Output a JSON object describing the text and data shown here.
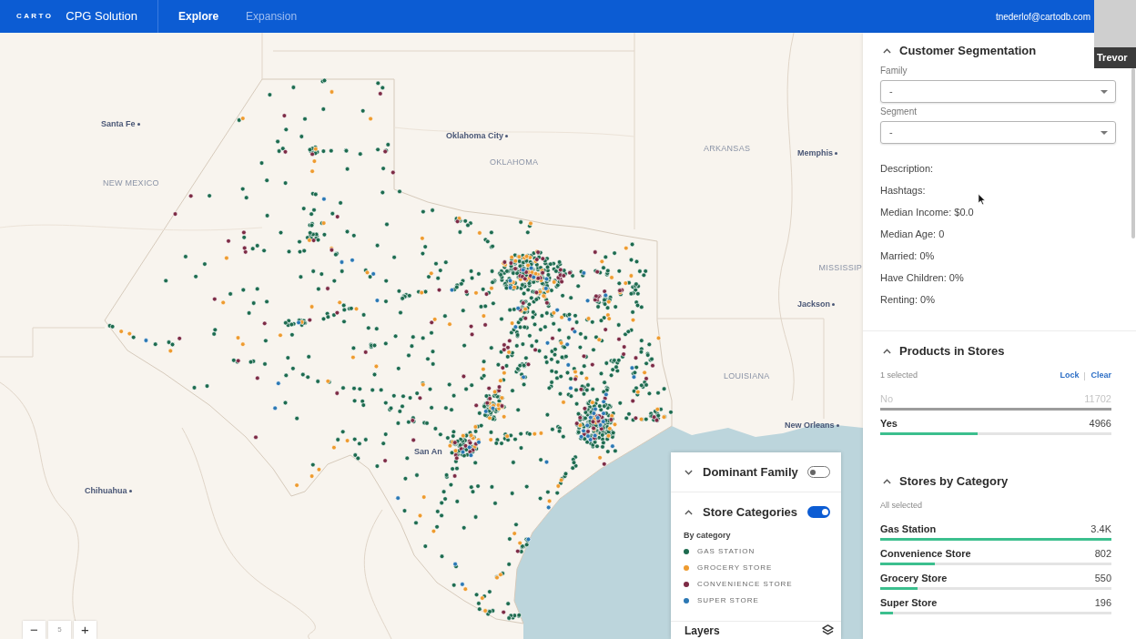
{
  "header": {
    "logo": "CARTO",
    "app_title": "CPG Solution",
    "nav": [
      {
        "label": "Explore",
        "selected": true
      },
      {
        "label": "Expansion",
        "selected": false
      }
    ],
    "user_email": "tnederlof@cartodb.com"
  },
  "video_overlay": {
    "name": "Trevor"
  },
  "map": {
    "labels": [
      {
        "kind": "city",
        "text": "Santa Fe"
      },
      {
        "kind": "city",
        "text": "Oklahoma City"
      },
      {
        "kind": "state",
        "text": "ARKANSAS"
      },
      {
        "kind": "city",
        "text": "Memphis"
      },
      {
        "kind": "state",
        "text": "OKLAHOMA"
      },
      {
        "kind": "state",
        "text": "NEW MEXICO"
      },
      {
        "kind": "state",
        "text": "MISSISSIP"
      },
      {
        "kind": "city",
        "text": "Jackson"
      },
      {
        "kind": "state",
        "text": "LOUISIANA"
      },
      {
        "kind": "city",
        "text": "New Orleans"
      },
      {
        "kind": "place",
        "text": "San An"
      },
      {
        "kind": "city",
        "text": "Chihuahua"
      }
    ],
    "zoom": {
      "minus": "−",
      "value": "5",
      "plus": "+"
    },
    "legend": {
      "sections": [
        {
          "title": "Dominant Family",
          "expanded": false,
          "on": false
        },
        {
          "title": "Store Categories",
          "expanded": true,
          "on": true,
          "subtitle": "By category",
          "items": [
            {
              "label": "GAS STATION",
              "color": "#1d6b4f"
            },
            {
              "label": "GROCERY STORE",
              "color": "#ee9b2f"
            },
            {
              "label": "CONVENIENCE STORE",
              "color": "#7d2b45"
            },
            {
              "label": "SUPER STORE",
              "color": "#2b78b4"
            }
          ]
        }
      ],
      "layers_title": "Layers"
    }
  },
  "sidebar": {
    "sections": [
      {
        "kind": "segmentation",
        "title": "Customer Segmentation",
        "expanded": true,
        "fields": [
          {
            "label": "Family",
            "value": "-"
          },
          {
            "label": "Segment",
            "value": "-"
          }
        ],
        "stats": [
          "Description:",
          "Hashtags:",
          "Median Income: $0.0",
          "Median Age: 0",
          "Married: 0%",
          "Have Children: 0%",
          "Renting: 0%"
        ]
      },
      {
        "kind": "bars",
        "title": "Products in Stores",
        "expanded": true,
        "summary": "1 selected",
        "actions": [
          "Lock",
          "Clear"
        ],
        "rows": [
          {
            "label": "No",
            "value": "11702",
            "level": 1,
            "selected": false
          },
          {
            "label": "Yes",
            "value": "4966",
            "level": 0.42,
            "selected": true
          }
        ]
      },
      {
        "kind": "bars",
        "title": "Stores by Category",
        "expanded": true,
        "summary": "All selected",
        "rows": [
          {
            "label": "Gas Station",
            "value": "3.4K",
            "level": 1,
            "selected": true
          },
          {
            "label": "Convenience Store",
            "value": "802",
            "level": 0.235,
            "selected": true
          },
          {
            "label": "Grocery Store",
            "value": "550",
            "level": 0.16,
            "selected": true
          },
          {
            "label": "Super Store",
            "value": "196",
            "level": 0.057,
            "selected": true
          }
        ]
      }
    ]
  }
}
